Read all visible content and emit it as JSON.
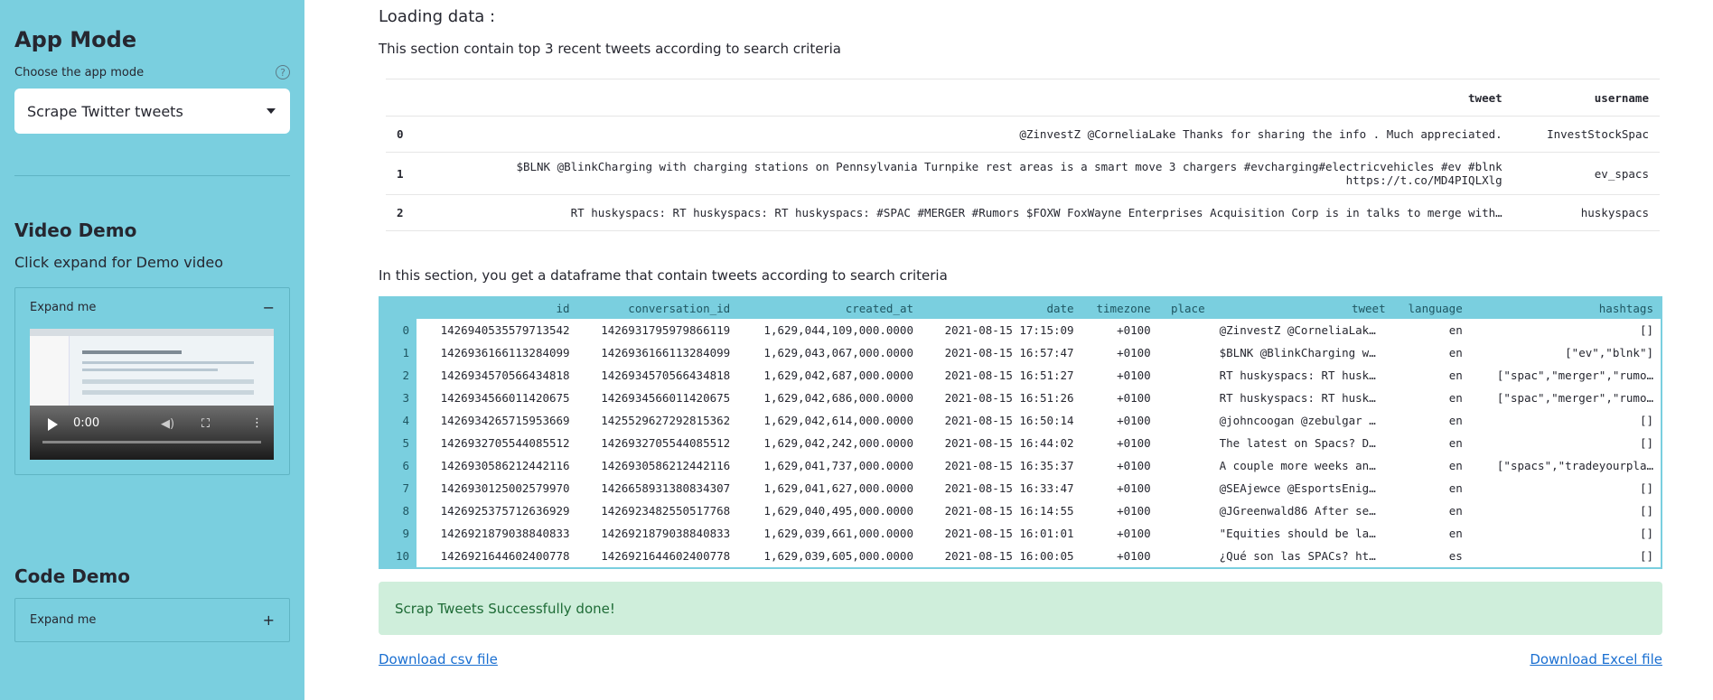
{
  "sidebar": {
    "title": "App Mode",
    "choose_label": "Choose the app mode",
    "help_icon": "question-circle-icon",
    "select_value": "Scrape Twitter tweets",
    "video_heading": "Video Demo",
    "video_text": "Click expand for Demo video",
    "video_expander_label": "Expand me",
    "video_expander_sign": "−",
    "video_time": "0:00",
    "code_heading": "Code Demo",
    "code_expander_label": "Expand me",
    "code_expander_sign": "+"
  },
  "main": {
    "loading_heading": "Loading data :",
    "section1_text": "This section contain top 3 recent tweets according to search criteria",
    "tweet_table": {
      "headers": [
        "",
        "tweet",
        "username"
      ],
      "rows": [
        {
          "idx": "0",
          "tweet": "@ZinvestZ @CorneliaLake Thanks for sharing the info . Much appreciated.",
          "username": "InvestStockSpac"
        },
        {
          "idx": "1",
          "tweet": "$BLNK @BlinkCharging with charging stations on Pennsylvania Turnpike rest areas is a smart move 3 chargers #evcharging#electricvehicles #ev #blnk https://t.co/MD4PIQLXlg",
          "username": "ev_spacs"
        },
        {
          "idx": "2",
          "tweet": "RT huskyspacs: RT huskyspacs: RT huskyspacs: #SPAC #MERGER #Rumors $FOXW FoxWayne Enterprises Acquisition Corp is in talks to merge with…",
          "username": "huskyspacs"
        }
      ]
    },
    "section2_text": "In this section, you get a dataframe that contain tweets according to search criteria",
    "dataframe": {
      "headers": [
        "",
        "id",
        "conversation_id",
        "created_at",
        "date",
        "timezone",
        "place",
        "tweet",
        "language",
        "hashtags"
      ],
      "rows": [
        [
          "0",
          "1426940535579713542",
          "1426931795979866119",
          "1,629,044,109,000.0000",
          "2021-08-15 17:15:09",
          "+0100",
          "",
          "@ZinvestZ @CorneliaLak…",
          "en",
          "[]"
        ],
        [
          "1",
          "1426936166113284099",
          "1426936166113284099",
          "1,629,043,067,000.0000",
          "2021-08-15 16:57:47",
          "+0100",
          "",
          "$BLNK @BlinkCharging w…",
          "en",
          "[\"ev\",\"blnk\"]"
        ],
        [
          "2",
          "1426934570566434818",
          "1426934570566434818",
          "1,629,042,687,000.0000",
          "2021-08-15 16:51:27",
          "+0100",
          "",
          "RT huskyspacs: RT husk…",
          "en",
          "[\"spac\",\"merger\",\"rumo…"
        ],
        [
          "3",
          "1426934566011420675",
          "1426934566011420675",
          "1,629,042,686,000.0000",
          "2021-08-15 16:51:26",
          "+0100",
          "",
          "RT huskyspacs: RT husk…",
          "en",
          "[\"spac\",\"merger\",\"rumo…"
        ],
        [
          "4",
          "1426934265715953669",
          "1425529627292815362",
          "1,629,042,614,000.0000",
          "2021-08-15 16:50:14",
          "+0100",
          "",
          "@johncoogan @zebulgar …",
          "en",
          "[]"
        ],
        [
          "5",
          "1426932705544085512",
          "1426932705544085512",
          "1,629,042,242,000.0000",
          "2021-08-15 16:44:02",
          "+0100",
          "",
          "The latest on Spacs? D…",
          "en",
          "[]"
        ],
        [
          "6",
          "1426930586212442116",
          "1426930586212442116",
          "1,629,041,737,000.0000",
          "2021-08-15 16:35:37",
          "+0100",
          "",
          "A couple more weeks an…",
          "en",
          "[\"spacs\",\"tradeyourpla…"
        ],
        [
          "7",
          "1426930125002579970",
          "1426658931380834307",
          "1,629,041,627,000.0000",
          "2021-08-15 16:33:47",
          "+0100",
          "",
          "@SEAjewce @EsportsEnig…",
          "en",
          "[]"
        ],
        [
          "8",
          "1426925375712636929",
          "1426923482550517768",
          "1,629,040,495,000.0000",
          "2021-08-15 16:14:55",
          "+0100",
          "",
          "@JGreenwald86 After se…",
          "en",
          "[]"
        ],
        [
          "9",
          "1426921879038840833",
          "1426921879038840833",
          "1,629,039,661,000.0000",
          "2021-08-15 16:01:01",
          "+0100",
          "",
          "\"Equities should be la…",
          "en",
          "[]"
        ],
        [
          "10",
          "1426921644602400778",
          "1426921644602400778",
          "1,629,039,605,000.0000",
          "2021-08-15 16:00:05",
          "+0100",
          "",
          "¿Qué son las SPACs? ht…",
          "es",
          "[]"
        ]
      ]
    },
    "success_text": "Scrap Tweets Successfully done!",
    "download_csv": "Download csv file",
    "download_excel": "Download Excel file"
  },
  "colors": {
    "sidebar_bg": "#7acfdf",
    "success_bg": "#cfeedb",
    "link": "#1a6fd1"
  }
}
